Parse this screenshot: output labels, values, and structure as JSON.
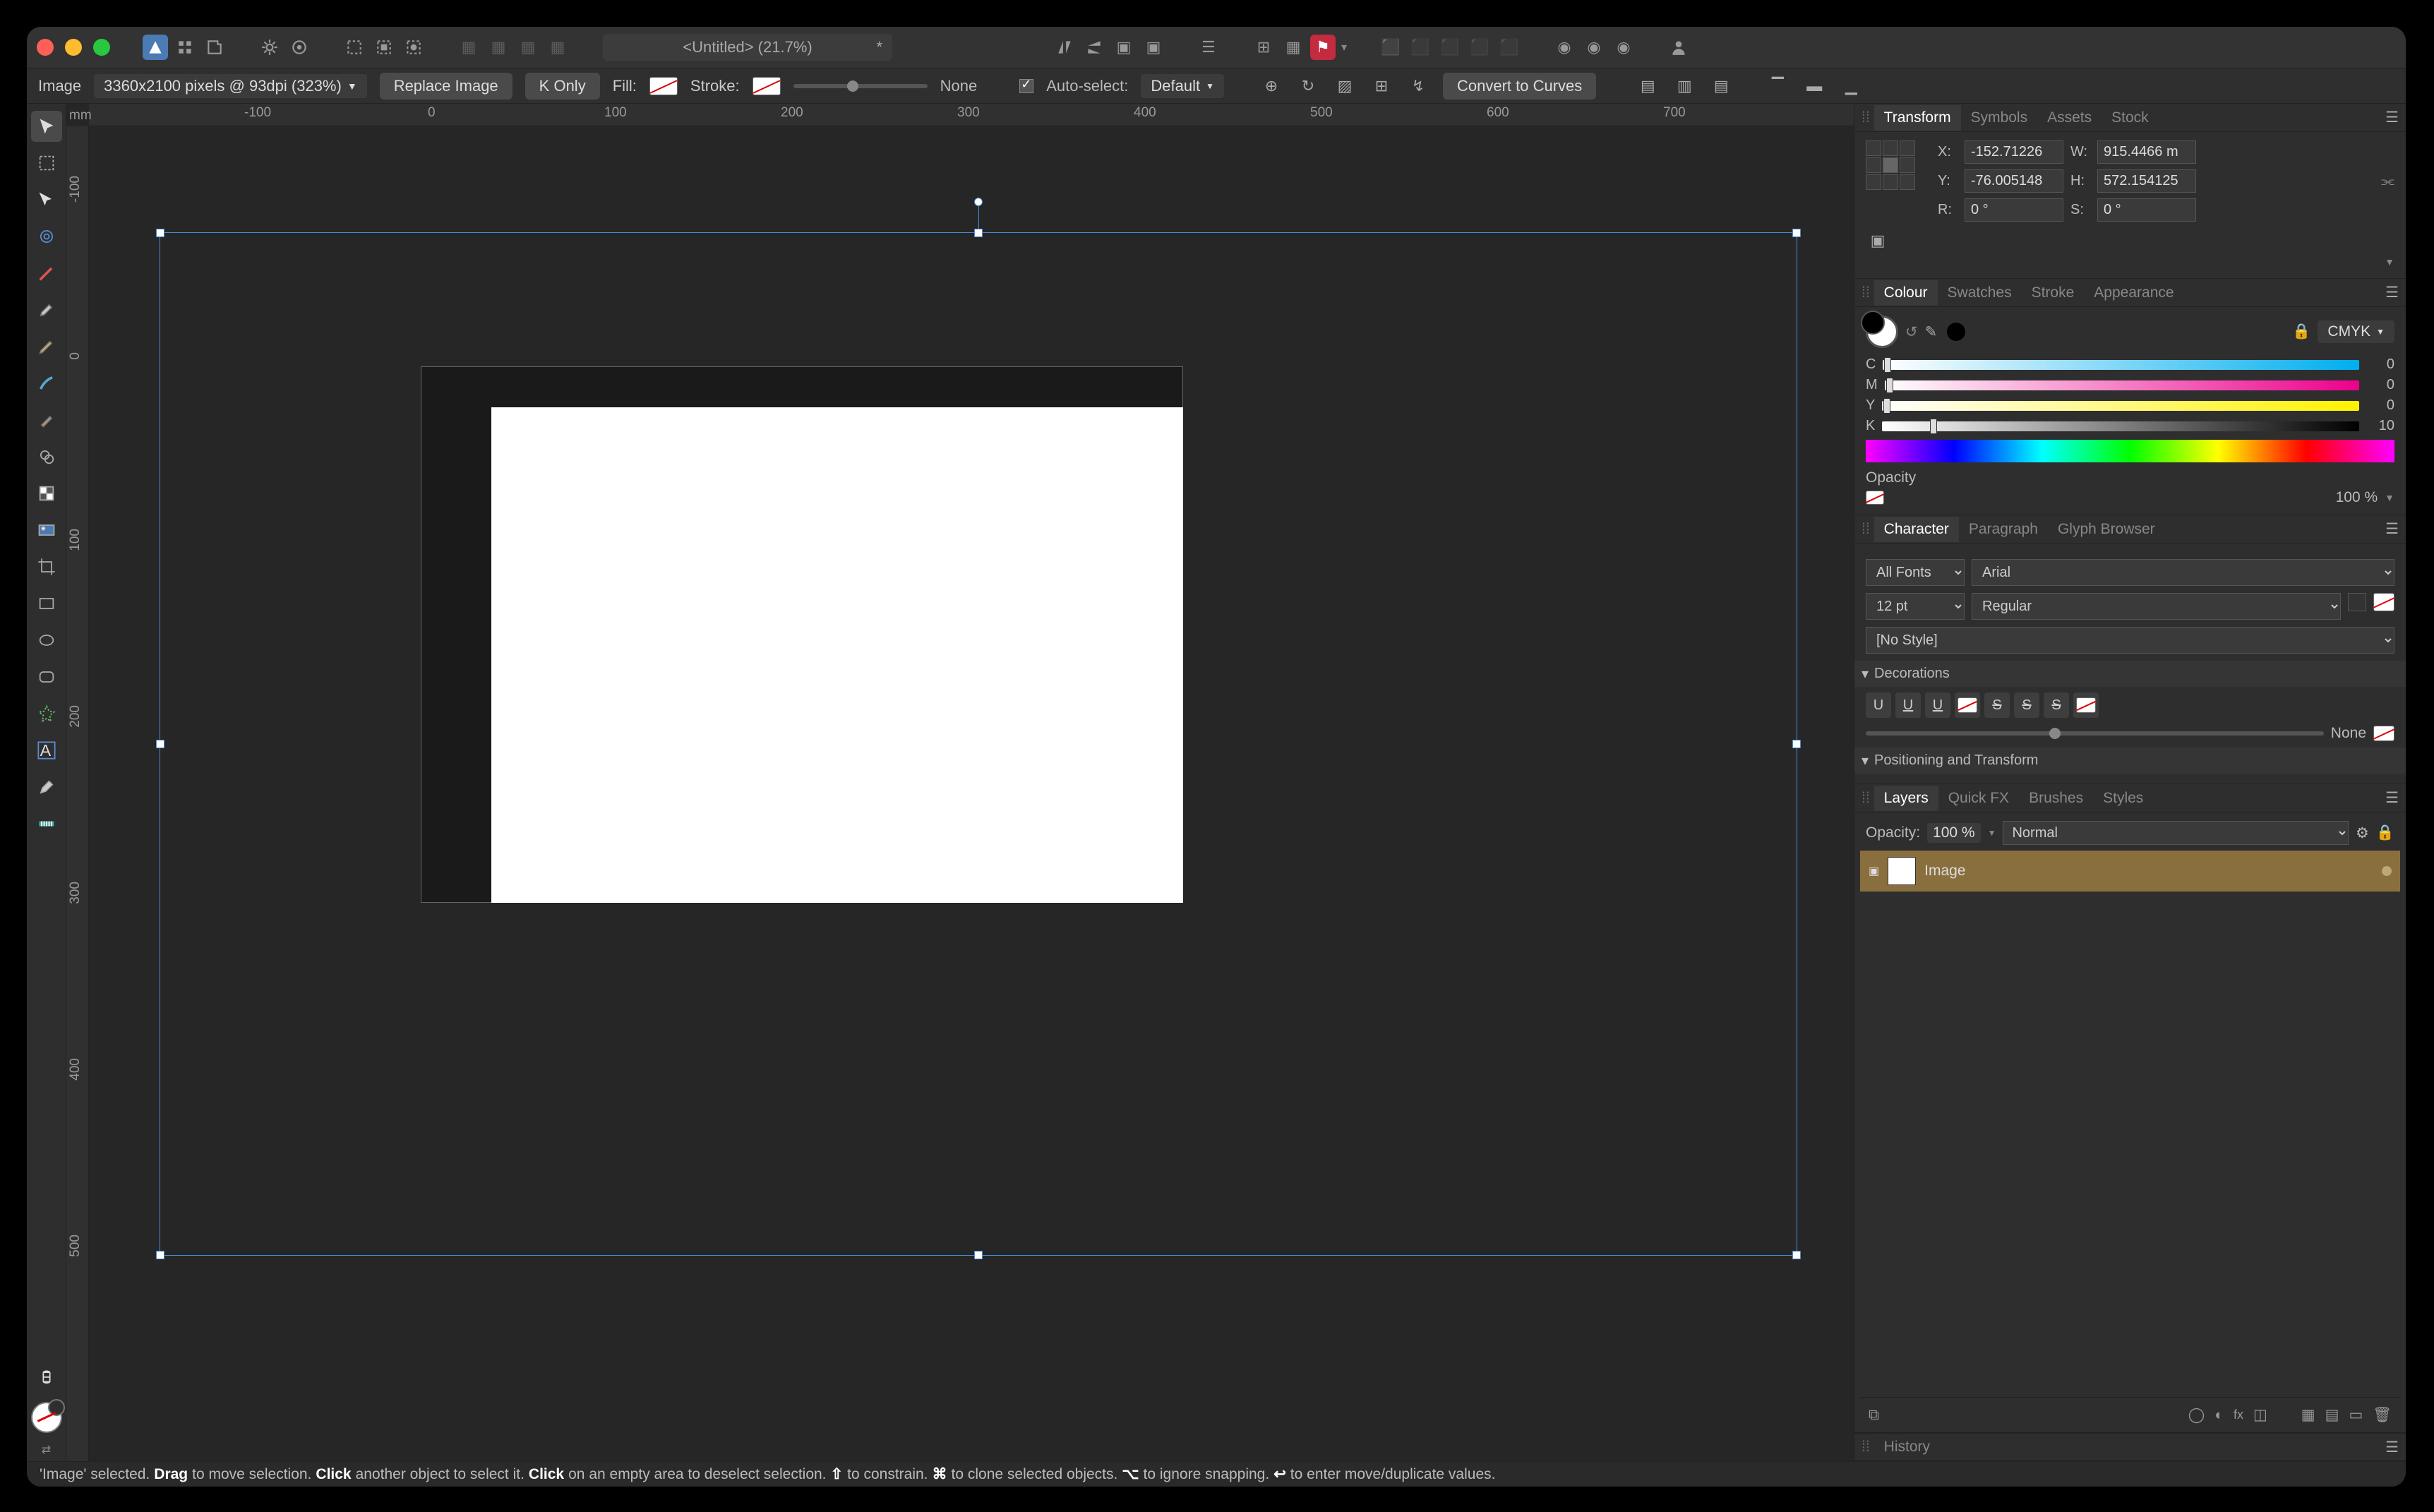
{
  "window": {
    "title": "<Untitled> (21.7%)",
    "modified": "*"
  },
  "toolbar2": {
    "context_label": "Image",
    "image_info": "3360x2100 pixels @ 93dpi (323%)",
    "replace": "Replace Image",
    "konly": "K Only",
    "fill_label": "Fill:",
    "stroke_label": "Stroke:",
    "stroke_val": "None",
    "autosel": "Auto-select:",
    "autosel_val": "Default",
    "convert": "Convert to Curves"
  },
  "ruler": {
    "unit": "mm",
    "h": [
      "-100",
      "0",
      "100",
      "200",
      "300",
      "400",
      "500",
      "600",
      "700"
    ],
    "v": [
      "-100",
      "0",
      "100",
      "200",
      "300",
      "400",
      "500"
    ]
  },
  "right": {
    "transform": {
      "tabs": [
        "Transform",
        "Symbols",
        "Assets",
        "Stock"
      ],
      "x": "-152.71226",
      "y": "-76.005148",
      "w": "915.4466 m",
      "h": "572.154125",
      "r": "0 °",
      "s": "0 °",
      "xl": "X:",
      "yl": "Y:",
      "wl": "W:",
      "hl": "H:",
      "rl": "R:",
      "sl": "S:"
    },
    "colour": {
      "tabs": [
        "Colour",
        "Swatches",
        "Stroke",
        "Appearance"
      ],
      "mode": "CMYK",
      "c": {
        "l": "C",
        "v": "0"
      },
      "m": {
        "l": "M",
        "v": "0"
      },
      "y": {
        "l": "Y",
        "v": "0"
      },
      "k": {
        "l": "K",
        "v": "10"
      },
      "opacity_label": "Opacity",
      "opacity": "100 %"
    },
    "char": {
      "tabs": [
        "Character",
        "Paragraph",
        "Glyph Browser"
      ],
      "fonts": "All Fonts",
      "family": "Arial",
      "size": "12 pt",
      "weight": "Regular",
      "style": "[No Style]",
      "sec1": "Decorations",
      "sec2": "Positioning and Transform",
      "none": "None"
    },
    "layers": {
      "tabs": [
        "Layers",
        "Quick FX",
        "Brushes",
        "Styles"
      ],
      "op_label": "Opacity:",
      "op": "100 %",
      "blend": "Normal",
      "item": "Image"
    },
    "history": {
      "label": "History"
    }
  },
  "status": {
    "pre": "'Image' selected.",
    "drag": "Drag",
    "drag_t": " to move selection. ",
    "click": "Click",
    "click_t": " another object to select it. ",
    "click2": "Click",
    "click2_t": " on an empty area to deselect selection. ",
    "sh": "⇧",
    "sh_t": " to constrain. ",
    "cmd": "⌘",
    "cmd_t": " to clone selected objects. ",
    "opt": "⌥",
    "opt_t": " to ignore snapping. ",
    "ret": "↩",
    "ret_t": " to enter move/duplicate values."
  }
}
